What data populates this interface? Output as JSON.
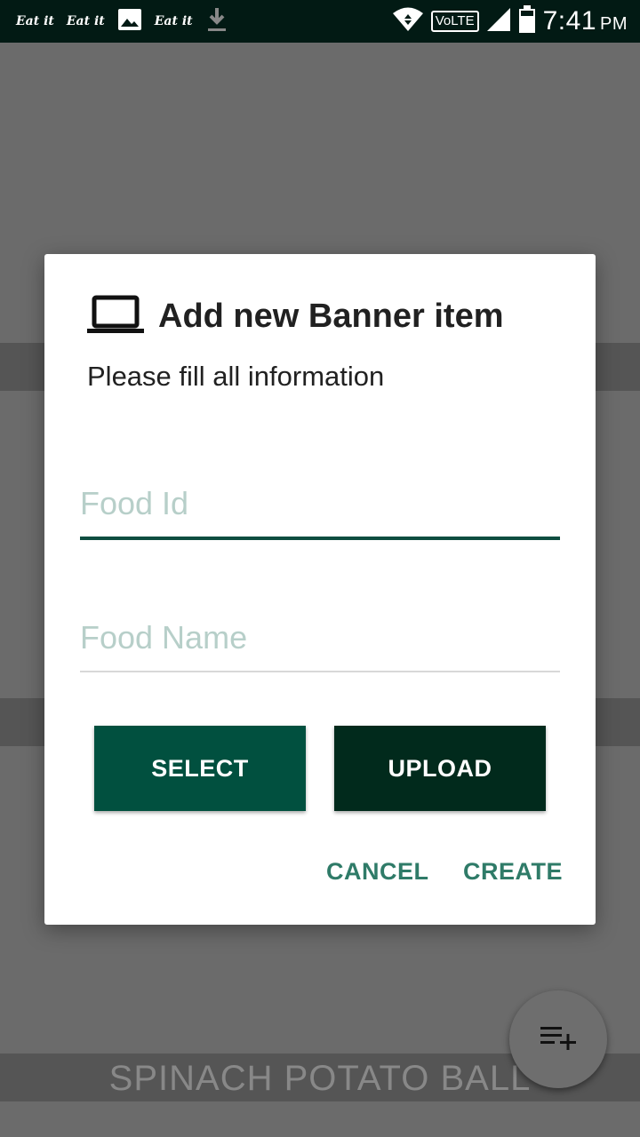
{
  "status_bar": {
    "notifications": [
      "Eat it",
      "Eat it",
      "Eat it"
    ],
    "network": "VoLTE",
    "time": "7:41",
    "ampm": "PM"
  },
  "background": {
    "visible_item_title": "SPINACH POTATO BALL"
  },
  "dialog": {
    "icon": "laptop-icon",
    "title": "Add new Banner item",
    "message": "Please fill all information",
    "food_id": {
      "value": "",
      "placeholder": "Food Id"
    },
    "food_name": {
      "value": "",
      "placeholder": "Food Name"
    },
    "select_label": "SELECT",
    "upload_label": "UPLOAD",
    "cancel_label": "CANCEL",
    "create_label": "CREATE"
  },
  "fab": {
    "icon": "playlist-add-icon"
  },
  "colors": {
    "status_bar": "#021a14",
    "primary": "#01503f",
    "primary_dark": "#012a1c",
    "accent_text": "#2f7b68",
    "hint": "#b7cfc9"
  }
}
